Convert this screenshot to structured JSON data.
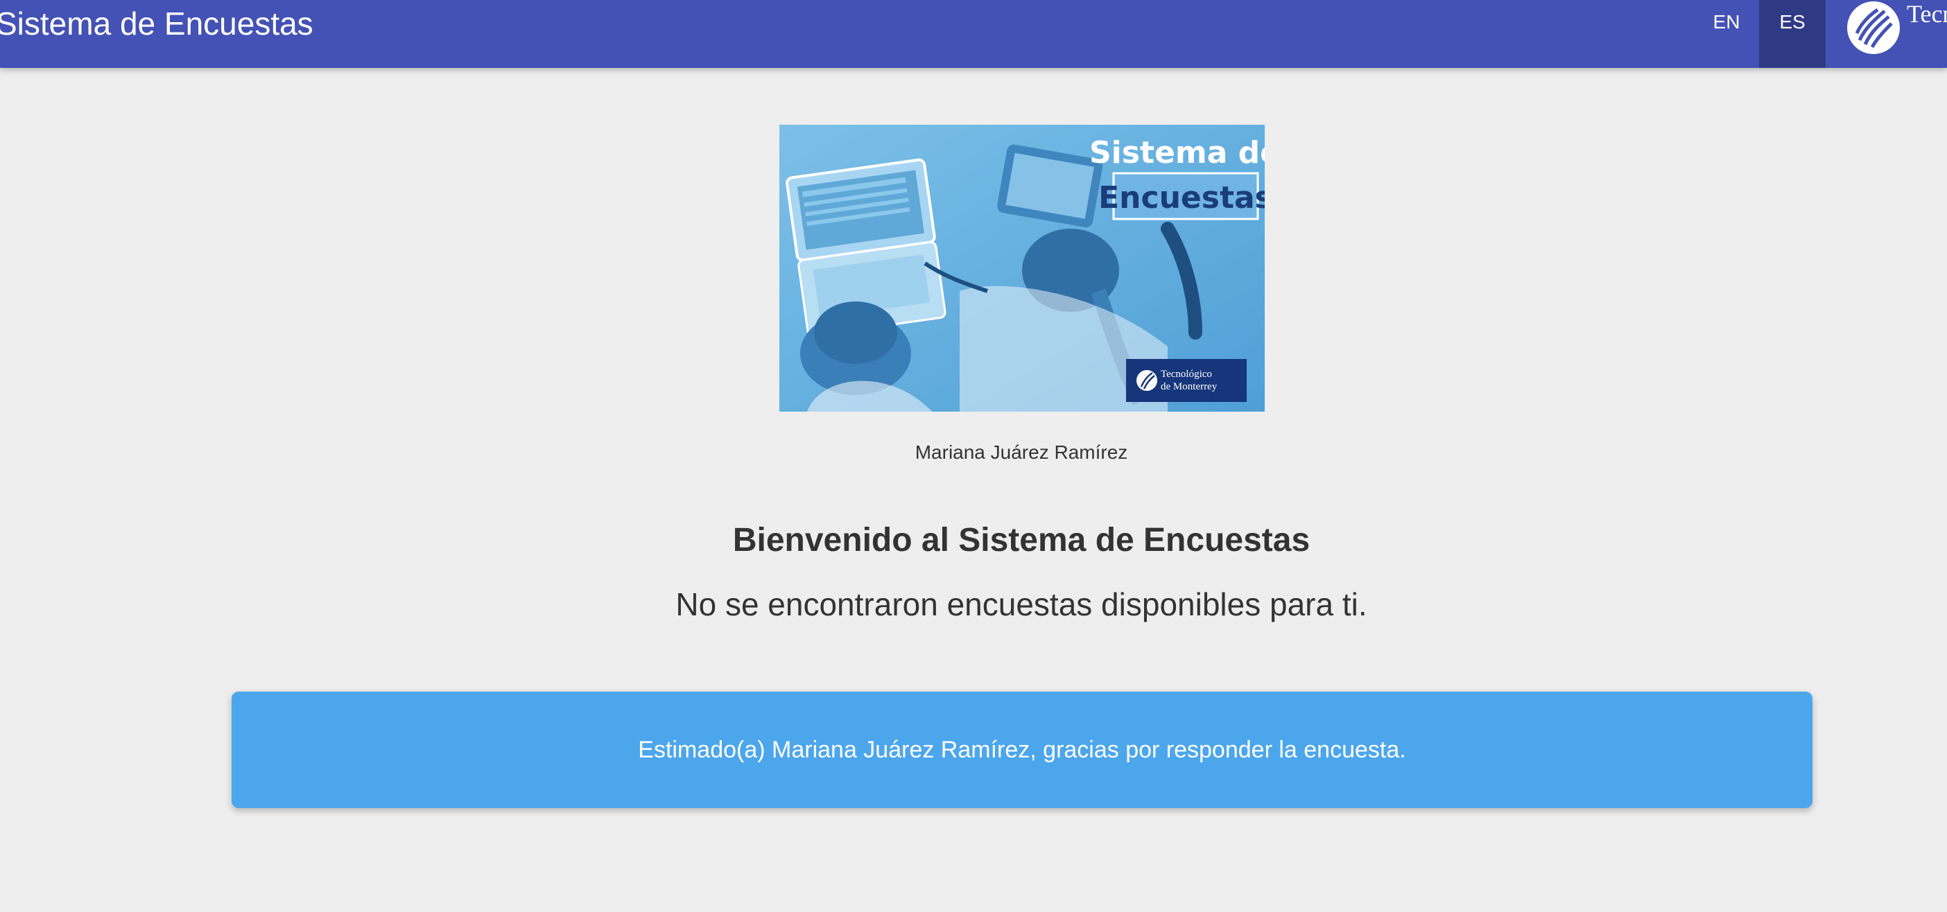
{
  "header": {
    "title": "Sistema de Encuestas",
    "languages": [
      {
        "code": "EN",
        "active": false
      },
      {
        "code": "ES",
        "active": true
      }
    ],
    "brand_text": "Tecnológico de Monterrey",
    "brand_icon": "tec-flame-logo-icon"
  },
  "banner": {
    "title_line1": "Sistema de",
    "title_line2": "Encuestas",
    "badge_line1": "Tecnológico",
    "badge_line2": "de Monterrey"
  },
  "main": {
    "user_name": "Mariana Juárez Ramírez",
    "welcome_heading": "Bienvenido al Sistema de Encuestas",
    "no_surveys_message": "No se encontraron encuestas disponibles para ti.",
    "thank_you_message": "Estimado(a) Mariana Juárez Ramírez, gracias por responder la encuesta."
  },
  "colors": {
    "header_bg": "#4452b5",
    "active_lang_bg": "#2f3a85",
    "page_bg": "#eeeeee",
    "alert_bg": "#4ca6ec",
    "text": "#333333"
  }
}
